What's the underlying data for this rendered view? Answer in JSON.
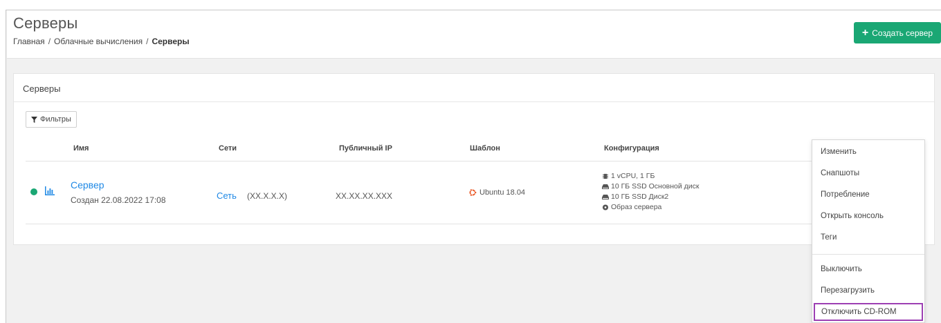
{
  "header": {
    "title": "Серверы",
    "breadcrumb": [
      "Главная",
      "Облачные вычисления",
      "Серверы"
    ],
    "breadcrumb_separator": "/",
    "create_button": "Создать сервер",
    "create_icon": "plus-icon",
    "accent_color": "#1aa774"
  },
  "panel": {
    "title": "Серверы",
    "filter_button": "Фильтры",
    "filter_icon": "funnel-icon",
    "columns": [
      "Имя",
      "Сети",
      "Публичный IP",
      "Шаблон",
      "Конфигурация"
    ]
  },
  "rows": [
    {
      "status": "active",
      "status_color": "#1aa774",
      "stats_icon": "bar-chart-icon",
      "name": "Сервер",
      "created": "Создан 22.08.2022 17:08",
      "network": "Сеть",
      "network_mask": "(XX.X.X.X)",
      "ip": "XX.XX.XX.XXX",
      "os_icon": "ubuntu-icon",
      "template": "Ubuntu 18.04",
      "config": [
        {
          "icon": "cpu-icon",
          "text": "1 vCPU, 1 ГБ"
        },
        {
          "icon": "disk-icon",
          "text": "10 ГБ SSD Основной диск"
        },
        {
          "icon": "disk-icon",
          "text": "10 ГБ SSD Диск2"
        },
        {
          "icon": "disc-icon",
          "text": "Образ сервера"
        }
      ]
    }
  ],
  "menu": {
    "items": [
      "Изменить",
      "Снапшоты",
      "Потребление",
      "Открыть консоль",
      "Теги"
    ],
    "items_bottom": [
      "Выключить",
      "Перезагрузить",
      "Отключить CD-ROM"
    ],
    "highlight_color": "#9c3fb3"
  },
  "link_color": "#1e88e5"
}
